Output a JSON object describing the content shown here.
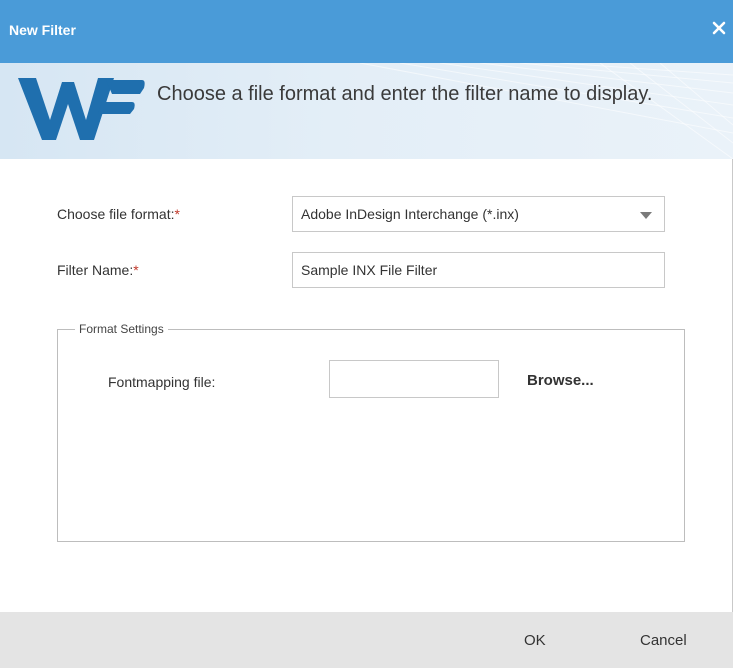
{
  "dialog": {
    "title": "New Filter",
    "close_icon": "close-icon"
  },
  "banner": {
    "logo": "WF",
    "text": "Choose a file format and enter the filter name to display."
  },
  "form": {
    "file_format_label": "Choose file format:",
    "file_format_required": "*",
    "file_format_value": "Adobe InDesign Interchange (*.inx)",
    "filter_name_label": "Filter Name:",
    "filter_name_required": "*",
    "filter_name_value": "Sample INX File Filter"
  },
  "format_settings": {
    "legend": "Format Settings",
    "fontmapping_label": "Fontmapping file:",
    "fontmapping_value": "",
    "browse_label": "Browse..."
  },
  "footer": {
    "ok_label": "OK",
    "cancel_label": "Cancel"
  },
  "colors": {
    "titlebar": "#4a9bd8",
    "logo_blue": "#1f6fae",
    "required": "#c0392b",
    "footer": "#e4e4e4"
  }
}
